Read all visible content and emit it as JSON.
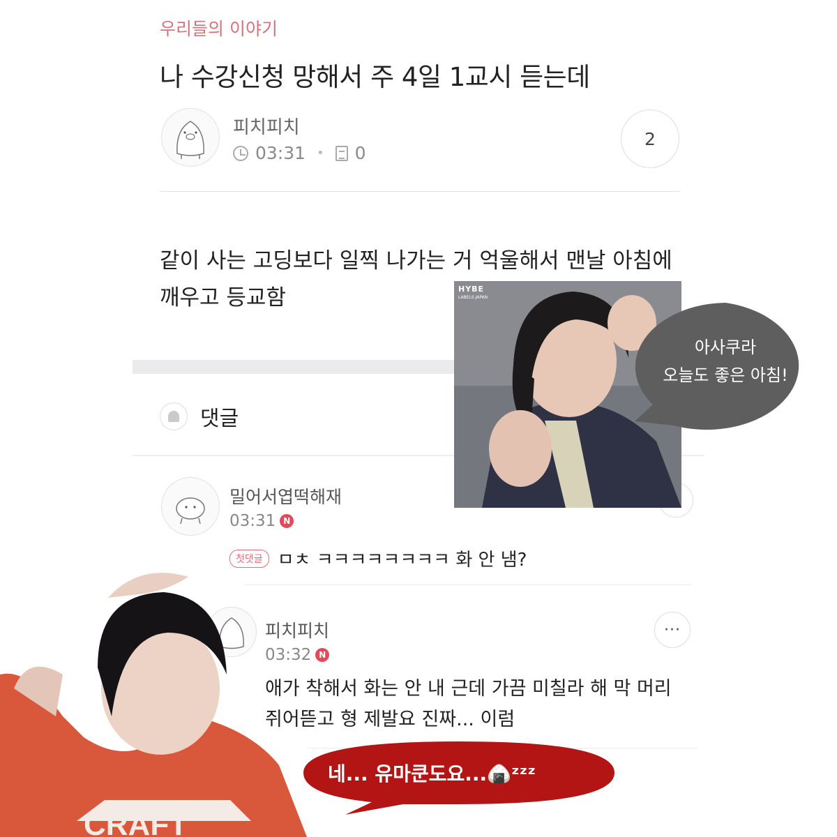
{
  "post": {
    "category": "우리들의 이야기",
    "title": "나 수강신청 망해서 주 4일 1교시 듣는데",
    "author": "피치피치",
    "time": "03:31",
    "comment_count": "0",
    "like_count": "2",
    "body": "같이 사는 고딩보다 일찍 나가는 거 억울해서 맨날 아침에 깨우고 등교함"
  },
  "comments_section": {
    "title": "댓글"
  },
  "comments": [
    {
      "author": "밀어서엽떡해재",
      "time": "03:31",
      "new_badge": "N",
      "first_badge": "첫댓글",
      "text": "ㅁㅊ ㅋㅋㅋㅋㅋㅋㅋㅋ 화 안 냄?"
    },
    {
      "author": "피치피치",
      "time": "03:32",
      "new_badge": "N",
      "more": "···",
      "text": "애가 착해서 화는 안 내 근데 가끔 미칠라 해 막 머리 쥐어뜯고 형 제발요 진짜... 이럼"
    }
  ],
  "stickers": {
    "photo1_label": "HYBE",
    "photo1_sublabel": "LABELS JAPAN",
    "bubble1_line1": "아사쿠라",
    "bubble1_line2": "오늘도 좋은 아침!",
    "bubble2": "네... 유마쿤도요...🍙ᶻᶻᶻ",
    "hoodie_text": "CRAFT"
  },
  "colors": {
    "category": "#d9707c",
    "new_badge": "#e04a5a",
    "bubble1": "#5e5e5e",
    "bubble2": "#b31515",
    "hoodie": "#d9573a"
  }
}
